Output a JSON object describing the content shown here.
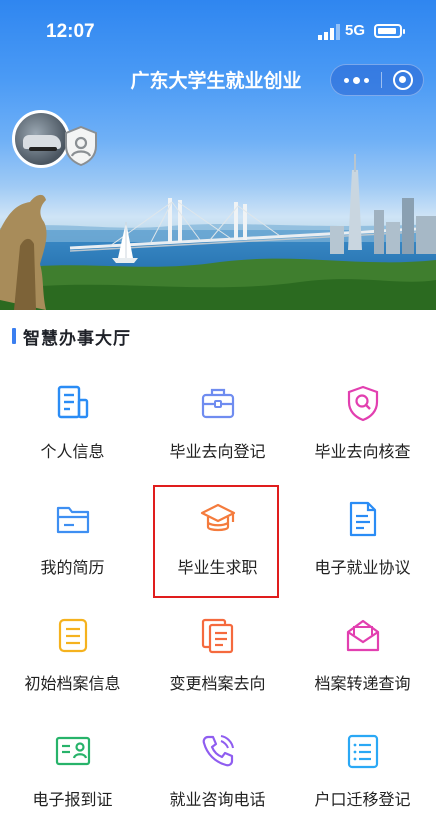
{
  "status_bar": {
    "time": "12:07",
    "network": "5G"
  },
  "nav": {
    "title": "广东大学生就业创业"
  },
  "section": {
    "title": "智慧办事大厅"
  },
  "services": [
    {
      "label": "个人信息",
      "icon": "profile-doc-icon",
      "color": "#2a8cf5"
    },
    {
      "label": "毕业去向登记",
      "icon": "briefcase-icon",
      "color": "#6f8cf0"
    },
    {
      "label": "毕业去向核查",
      "icon": "shield-search-icon",
      "color": "#e23fb0"
    },
    {
      "label": "我的简历",
      "icon": "folder-icon",
      "color": "#3e8ff2"
    },
    {
      "label": "毕业生求职",
      "icon": "graduation-cap-icon",
      "color": "#f47b3d"
    },
    {
      "label": "电子就业协议",
      "icon": "document-icon",
      "color": "#2a8cf5"
    },
    {
      "label": "初始档案信息",
      "icon": "file-list-icon",
      "color": "#f5b21e"
    },
    {
      "label": "变更档案去向",
      "icon": "files-icon",
      "color": "#f56a3e"
    },
    {
      "label": "档案转递查询",
      "icon": "envelope-icon",
      "color": "#e23fb0"
    },
    {
      "label": "电子报到证",
      "icon": "id-card-icon",
      "color": "#27b36a"
    },
    {
      "label": "就业咨询电话",
      "icon": "phone-icon",
      "color": "#8f5df0"
    },
    {
      "label": "户口迁移登记",
      "icon": "list-icon",
      "color": "#2aa8f5"
    }
  ],
  "highlighted_service": "毕业生求职"
}
